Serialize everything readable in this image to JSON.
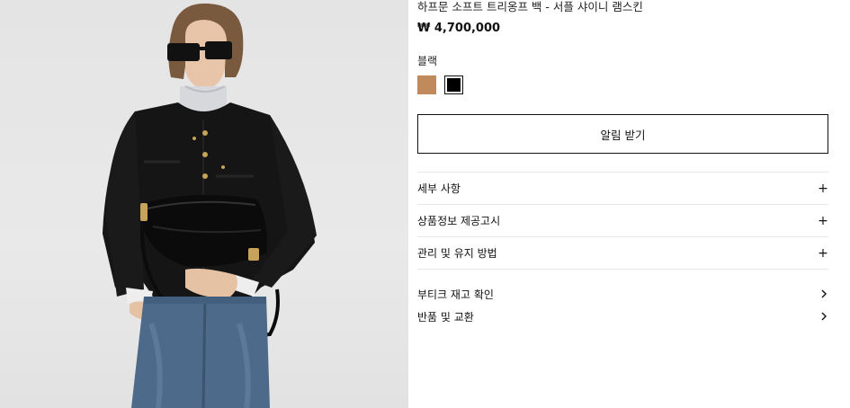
{
  "product": {
    "title": "하프문 소프트 트리옹프 백 - 서플 샤이니 램스킨",
    "price": "₩ 4,700,000",
    "color_label": "블랙",
    "swatches": [
      {
        "name": "tan",
        "color": "#c08a5c",
        "selected": false
      },
      {
        "name": "black",
        "color": "#000000",
        "selected": true
      }
    ],
    "notify_label": "알림 받기"
  },
  "accordion": [
    {
      "label": "세부 사항",
      "icon": "plus-icon"
    },
    {
      "label": "상품정보 제공고시",
      "icon": "plus-icon"
    },
    {
      "label": "관리 및 유지 방법",
      "icon": "plus-icon"
    }
  ],
  "links": [
    {
      "label": "부티크 재고 확인",
      "icon": "chevron-right-icon"
    },
    {
      "label": "반품 및 교환",
      "icon": "chevron-right-icon"
    }
  ]
}
